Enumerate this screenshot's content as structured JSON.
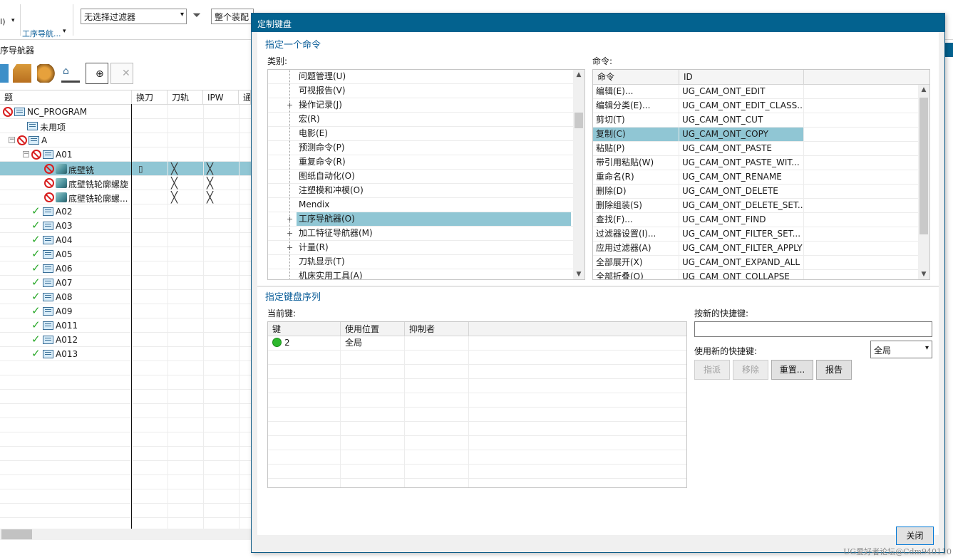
{
  "toolbar": {
    "partial_label": "I)",
    "nav_label": "工序导航...",
    "filter_value": "无选择过滤器",
    "assembly_value": "整个装配"
  },
  "navigator": {
    "title": "序导航器",
    "columns": [
      "题",
      "换刀",
      "刀轨",
      "IPW",
      "通"
    ],
    "rows": [
      {
        "name": "NC_PROGRAM",
        "status": "no",
        "icon": "folder-icon"
      },
      {
        "name": "未用项",
        "status": "",
        "icon": "folder-icon"
      },
      {
        "name": "A",
        "status": "no",
        "icon": "folder-icon"
      },
      {
        "name": "A01",
        "status": "no",
        "icon": "folder-icon"
      },
      {
        "name": "底壁铣",
        "status": "no",
        "icon": "operation-icon",
        "selected": true
      },
      {
        "name": "底壁铣轮廓螺旋",
        "status": "no",
        "icon": "operation-icon"
      },
      {
        "name": "底壁铣轮廓螺...",
        "status": "no",
        "icon": "operation-icon"
      },
      {
        "name": "A02",
        "status": "ok",
        "icon": "folder-icon"
      },
      {
        "name": "A03",
        "status": "ok",
        "icon": "folder-icon"
      },
      {
        "name": "A04",
        "status": "ok",
        "icon": "folder-icon"
      },
      {
        "name": "A05",
        "status": "ok",
        "icon": "folder-icon"
      },
      {
        "name": "A06",
        "status": "ok",
        "icon": "folder-icon"
      },
      {
        "name": "A07",
        "status": "ok",
        "icon": "folder-icon"
      },
      {
        "name": "A08",
        "status": "ok",
        "icon": "folder-icon"
      },
      {
        "name": "A09",
        "status": "ok",
        "icon": "folder-icon"
      },
      {
        "name": "A011",
        "status": "ok",
        "icon": "folder-icon"
      },
      {
        "name": "A012",
        "status": "ok",
        "icon": "folder-icon"
      },
      {
        "name": "A013",
        "status": "ok",
        "icon": "folder-icon"
      }
    ]
  },
  "dialog": {
    "title": "定制键盘",
    "section_command": "指定一个命令",
    "category_label": "类别:",
    "command_label": "命令:",
    "categories": [
      {
        "label": "问题管理(U)",
        "expandable": false
      },
      {
        "label": "可视报告(V)",
        "expandable": false
      },
      {
        "label": "操作记录(J)",
        "expandable": true
      },
      {
        "label": "宏(R)",
        "expandable": false
      },
      {
        "label": "电影(E)",
        "expandable": false
      },
      {
        "label": "预测命令(P)",
        "expandable": false
      },
      {
        "label": "重复命令(R)",
        "expandable": false
      },
      {
        "label": "图纸自动化(O)",
        "expandable": false
      },
      {
        "label": "注塑模和冲模(O)",
        "expandable": false
      },
      {
        "label": "Mendix",
        "expandable": false
      },
      {
        "label": "工序导航器(O)",
        "expandable": true,
        "selected": true
      },
      {
        "label": "加工特征导航器(M)",
        "expandable": true
      },
      {
        "label": "计量(R)",
        "expandable": true
      },
      {
        "label": "刀轨显示(T)",
        "expandable": false
      },
      {
        "label": "机床实用工具(A)",
        "expandable": false
      }
    ],
    "command_columns": [
      "命令",
      "ID"
    ],
    "commands": [
      {
        "name": "编辑(E)...",
        "id": "UG_CAM_ONT_EDIT"
      },
      {
        "name": "编辑分类(E)...",
        "id": "UG_CAM_ONT_EDIT_CLASS..."
      },
      {
        "name": "剪切(T)",
        "id": "UG_CAM_ONT_CUT"
      },
      {
        "name": "复制(C)",
        "id": "UG_CAM_ONT_COPY",
        "selected": true
      },
      {
        "name": "粘贴(P)",
        "id": "UG_CAM_ONT_PASTE"
      },
      {
        "name": "带引用粘贴(W)",
        "id": "UG_CAM_ONT_PASTE_WIT..."
      },
      {
        "name": "重命名(R)",
        "id": "UG_CAM_ONT_RENAME"
      },
      {
        "name": "删除(D)",
        "id": "UG_CAM_ONT_DELETE"
      },
      {
        "name": "删除组装(S)",
        "id": "UG_CAM_ONT_DELETE_SET..."
      },
      {
        "name": "查找(F)...",
        "id": "UG_CAM_ONT_FIND"
      },
      {
        "name": "过滤器设置(I)...",
        "id": "UG_CAM_ONT_FILTER_SET..."
      },
      {
        "name": "应用过滤器(A)",
        "id": "UG_CAM_ONT_FILTER_APPLY"
      },
      {
        "name": "全部展开(X)",
        "id": "UG_CAM_ONT_EXPAND_ALL"
      },
      {
        "name": "全部折叠(O)",
        "id": "UG_CAM_ONT_COLLAPSE"
      }
    ],
    "section_keys": "指定键盘序列",
    "current_keys_label": "当前键:",
    "key_columns": [
      "键",
      "使用位置",
      "抑制者"
    ],
    "keys": [
      {
        "key": "2",
        "location": "全局",
        "suppressor": ""
      }
    ],
    "new_shortcut_label": "按新的快捷键:",
    "new_shortcut_value": "",
    "use_new_label": "使用新的快捷键:",
    "use_scope_value": "全局",
    "btn_assign": "指派",
    "btn_remove": "移除",
    "btn_reset": "重置...",
    "btn_report": "报告",
    "btn_close": "关闭"
  },
  "watermark": "UG爱好者论坛@Cdm940110"
}
